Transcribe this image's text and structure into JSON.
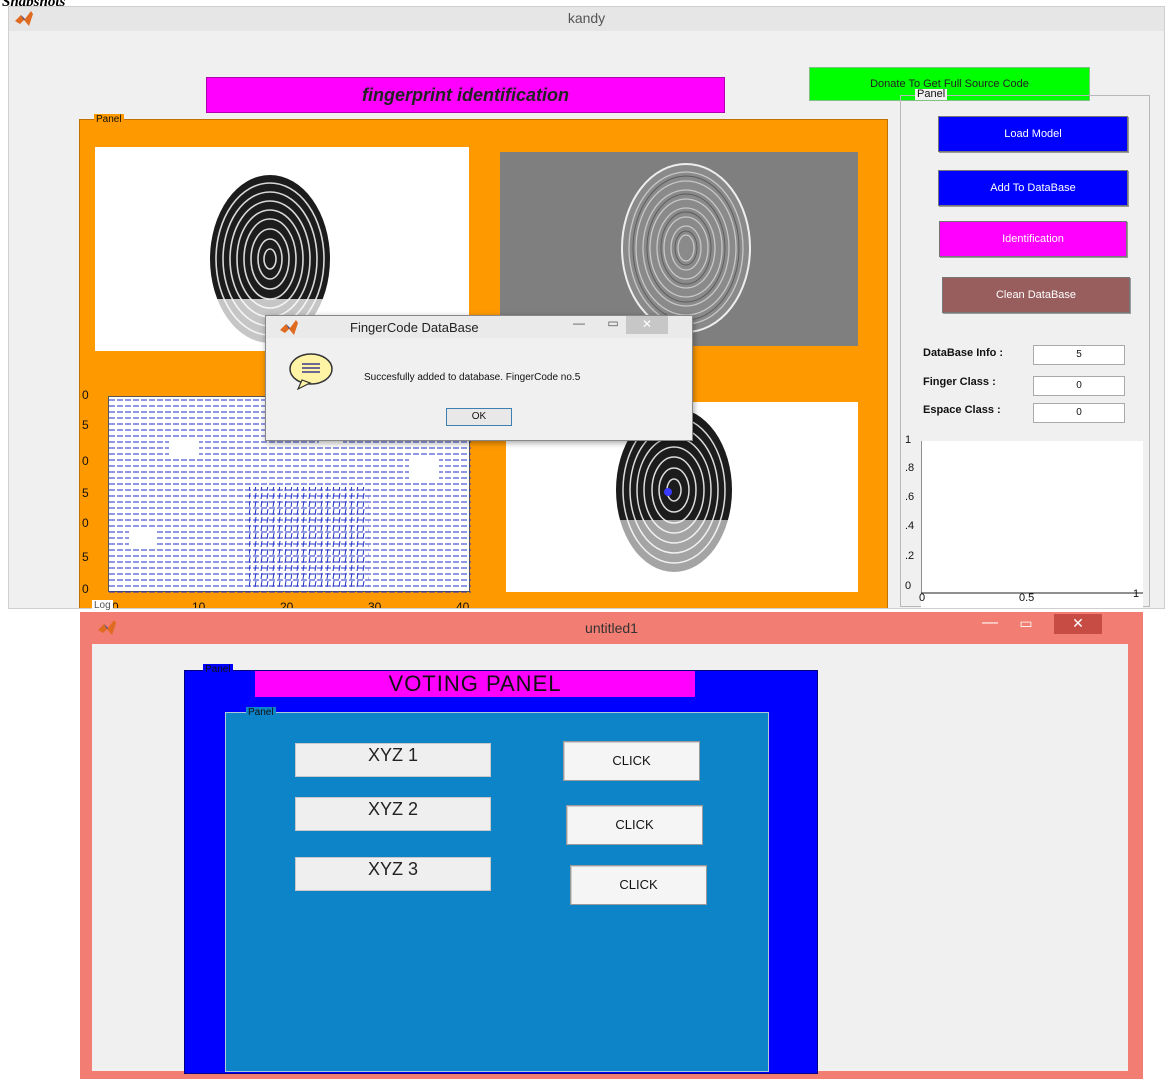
{
  "caption": "Snapshots",
  "main_window": {
    "title": "kandy",
    "heading": "fingerprint identification",
    "donate_button": "Donate To Get Full Source Code",
    "image_panel_label": "Panel",
    "side_panel_label": "Panel",
    "buttons": {
      "load_model": "Load Model",
      "add_to_database": "Add To DataBase",
      "identification": "Identification",
      "clean_database": "Clean DataBase"
    },
    "info": {
      "database_label": "DataBase Info :",
      "database_value": "5",
      "finger_class_label": "Finger Class :",
      "finger_class_value": "0",
      "espace_class_label": "Espace Class :",
      "espace_class_value": "0"
    },
    "orientation_axes": {
      "x_ticks": [
        "0",
        "10",
        "20",
        "30",
        "40"
      ],
      "y_ticks": [
        "0",
        "5",
        "0",
        "5",
        "0",
        "5",
        "0"
      ]
    },
    "mini_axes": {
      "y_ticks": [
        "1",
        ".8",
        ".6",
        ".4",
        ".2",
        "0"
      ],
      "x_ticks": [
        "0",
        "0.5",
        "1"
      ]
    },
    "bottom_label": "Log"
  },
  "dialog": {
    "title": "FingerCode DataBase",
    "message": "Succesfully added to database. FingerCode no.5",
    "ok_button": "OK"
  },
  "voting_window": {
    "title": "untitled1",
    "outer_panel_label": "Panel",
    "heading": "VOTING PANEL",
    "inner_panel_label": "Panel",
    "candidates": [
      "XYZ 1",
      "XYZ 2",
      "XYZ 3"
    ],
    "click_label": "CLICK"
  },
  "colors": {
    "title_magenta": "#ff00ff",
    "donate_green": "#00ff00",
    "image_panel_orange": "#ff9900",
    "button_blue": "#0000ff",
    "button_magenta": "#ff00ff",
    "button_brown": "#985e5e",
    "voting_frame": "#f27d72",
    "voting_outer": "#0000ff",
    "voting_inner": "#0d83c8"
  }
}
